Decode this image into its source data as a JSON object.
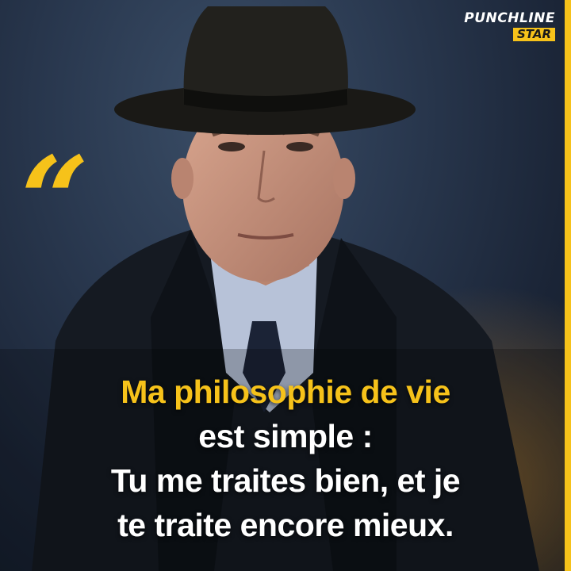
{
  "brand": {
    "line1": "PUNCHLINE",
    "line2": "STAR"
  },
  "quote_mark": "“",
  "quote": {
    "line1": "Ma philosophie de vie",
    "line2": "est simple :",
    "line3": "Tu me traites bien, et je",
    "line4": "te traite encore mieux."
  },
  "colors": {
    "accent": "#f6c21a",
    "text": "#ffffff",
    "background": "#1c2638"
  }
}
